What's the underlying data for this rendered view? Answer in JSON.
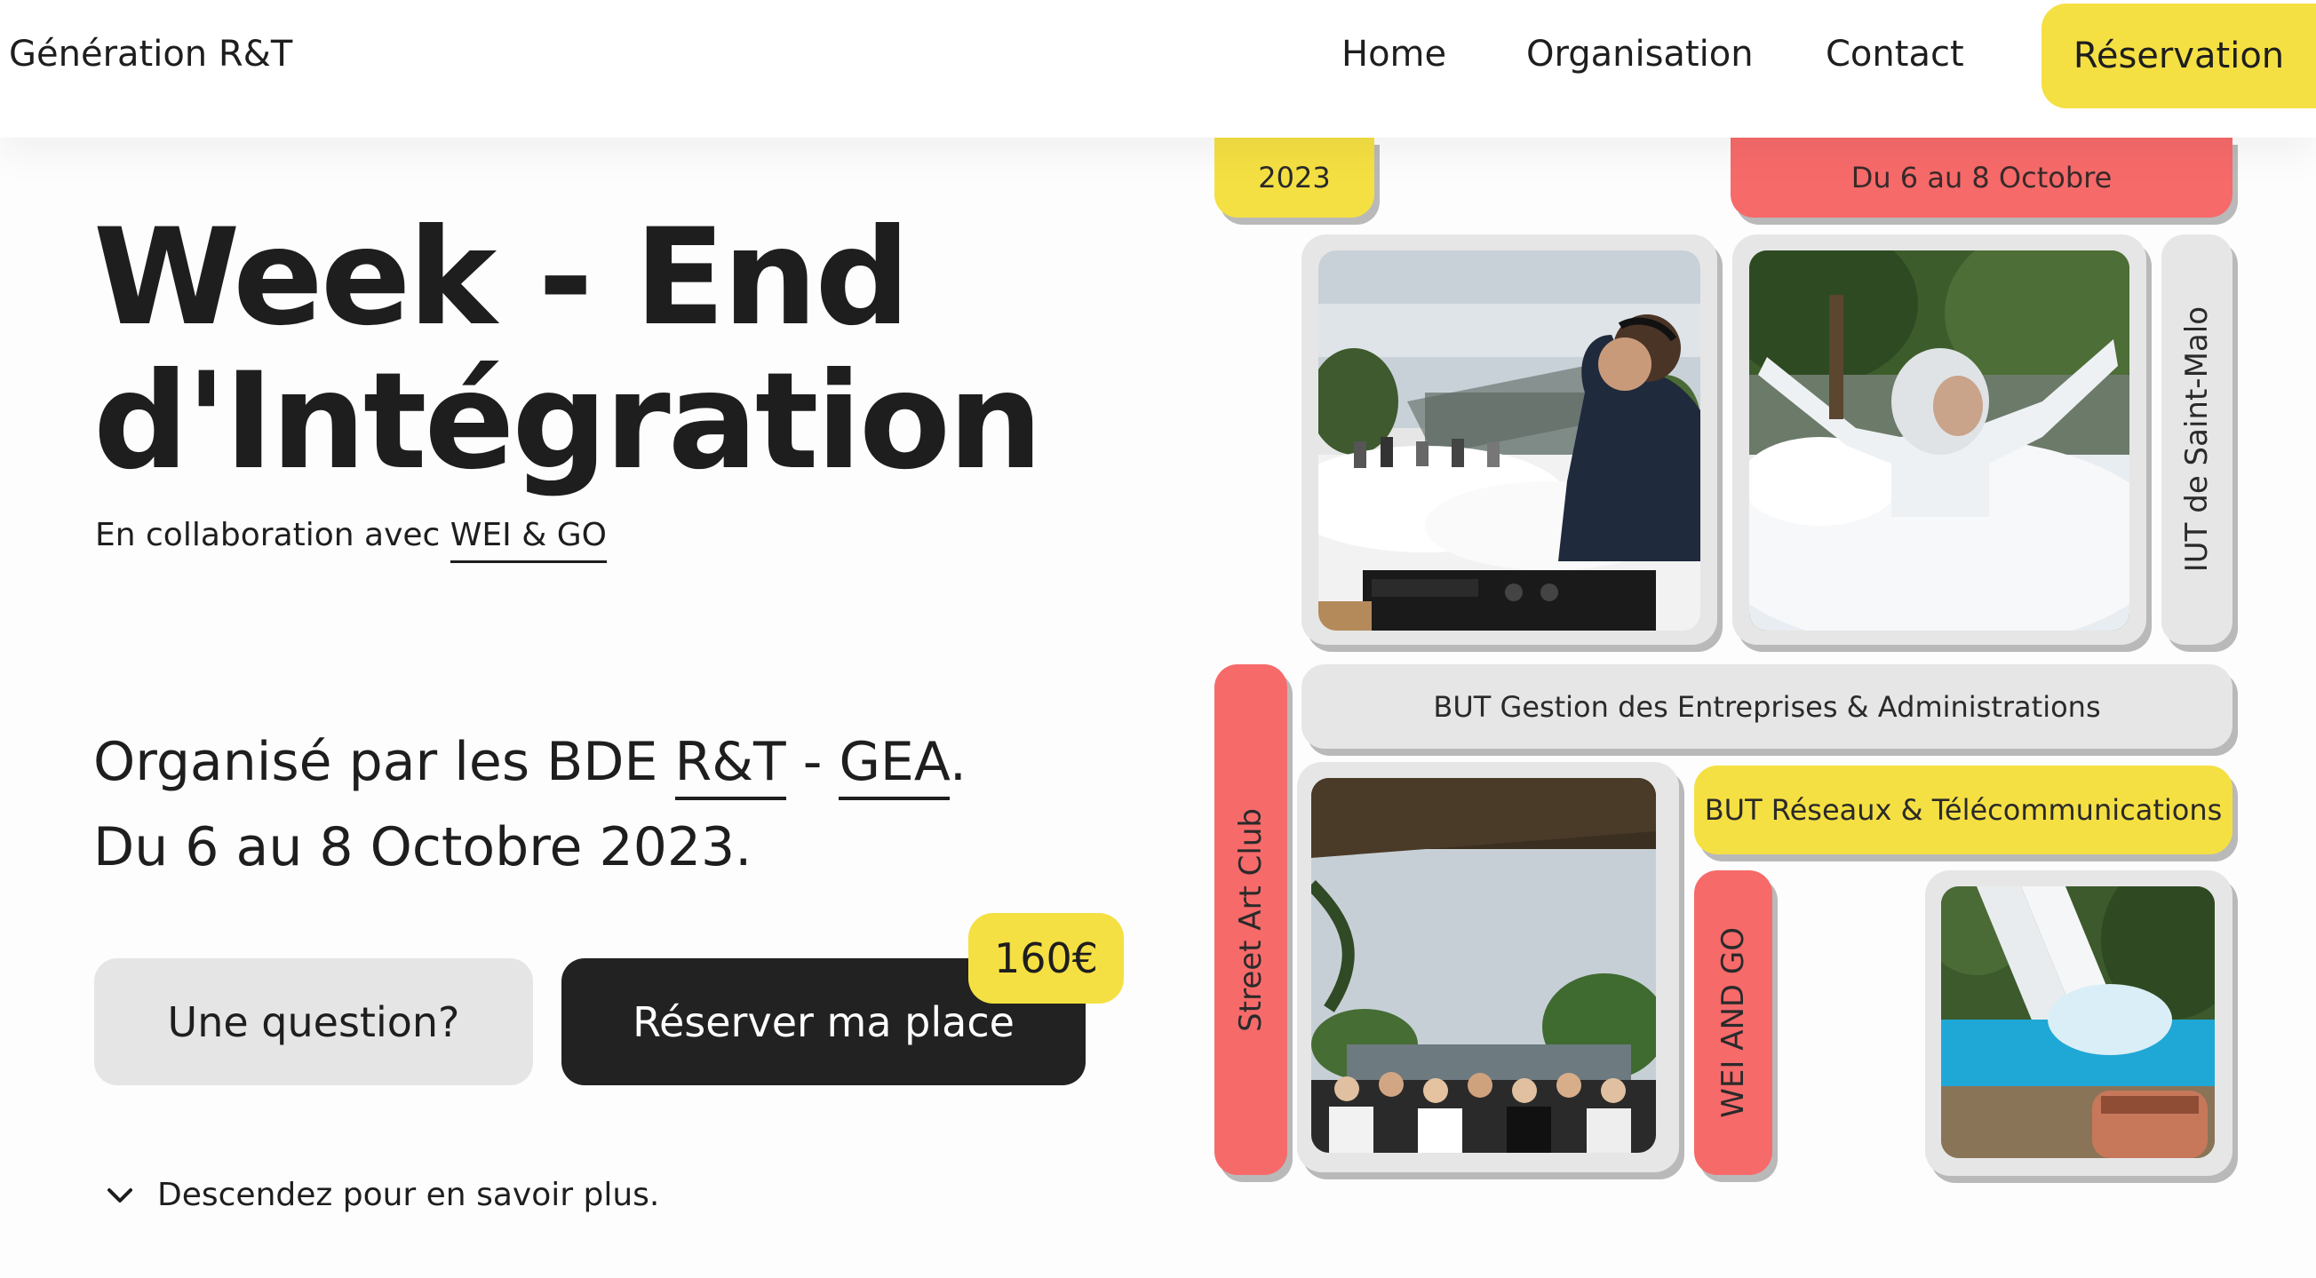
{
  "header": {
    "brand": "Génération R&T",
    "nav": {
      "home": "Home",
      "organisation": "Organisation",
      "contact": "Contact",
      "reservation": "Réservation"
    }
  },
  "hero": {
    "title_line1": "Week - End",
    "title_line2": "d'Intégration",
    "collab_prefix": "En collaboration avec",
    "collab_link": "WEI & GO",
    "organized_prefix": "Organisé par les BDE",
    "organized_rt": "R&T",
    "organized_sep": " - ",
    "organized_gea": "GEA",
    "organized_suffix": ".",
    "dates_line": "Du 6 au 8 Octobre 2023.",
    "question_button": "Une question?",
    "book_button": "Réserver ma place",
    "price": "160€",
    "scroll_hint": "Descendez pour en savoir plus."
  },
  "collage": {
    "year": "2023",
    "dates": "Du 6 au 8 Octobre",
    "iut": "IUT de Saint-Malo",
    "gea": "BUT Gestion des Entreprises & Administrations",
    "street_art": "Street Art Club",
    "rt": "BUT Réseaux & Télécommunications",
    "wei": "WEI AND GO"
  },
  "colors": {
    "accent_yellow": "#f5e043",
    "accent_red": "#f76a6a",
    "tile_grey": "#e6e6e6",
    "dark_button": "#222222"
  }
}
